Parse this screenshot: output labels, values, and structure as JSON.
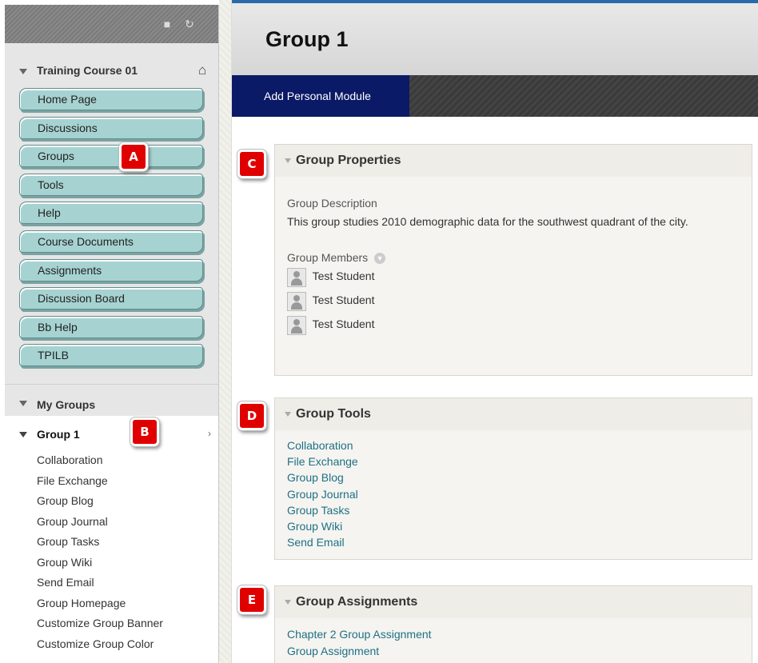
{
  "sidebar": {
    "toolbar": {
      "folder_icon": "folder-icon",
      "refresh_icon": "refresh-icon"
    },
    "course_title": "Training Course 01",
    "home_icon": "home-icon",
    "course_menu": [
      "Home Page",
      "Discussions",
      "Groups",
      "Tools",
      "Help",
      "Course Documents",
      "Assignments",
      "Discussion Board",
      "Bb Help",
      "TPILB"
    ],
    "my_groups_title": "My Groups",
    "group_name": "Group 1",
    "group_links": [
      "Collaboration",
      "File Exchange",
      "Group Blog",
      "Group Journal",
      "Group Tasks",
      "Group Wiki",
      "Send Email",
      "Group Homepage",
      "Customize Group Banner",
      "Customize Group Color"
    ]
  },
  "main": {
    "page_title": "Group 1",
    "add_module_label": "Add Personal Module",
    "properties": {
      "title": "Group Properties",
      "description_label": "Group Description",
      "description": "This group studies 2010 demographic data for the southwest quadrant of the city.",
      "members_label": "Group Members",
      "members": [
        "Test Student",
        "Test Student",
        "Test Student"
      ]
    },
    "tools": {
      "title": "Group Tools",
      "links": [
        "Collaboration",
        "File Exchange",
        "Group Blog",
        "Group Journal",
        "Group Tasks",
        "Group Wiki",
        "Send Email"
      ]
    },
    "assignments": {
      "title": "Group Assignments",
      "links": [
        "Chapter 2 Group Assignment",
        "Group Assignment"
      ]
    }
  },
  "callouts": {
    "a": "A",
    "b": "B",
    "c": "C",
    "d": "D",
    "e": "E"
  },
  "colors": {
    "menu_button": "#a6d3d1",
    "action_button": "#0a1a66",
    "callout": "#e00000",
    "link": "#1e7085"
  }
}
